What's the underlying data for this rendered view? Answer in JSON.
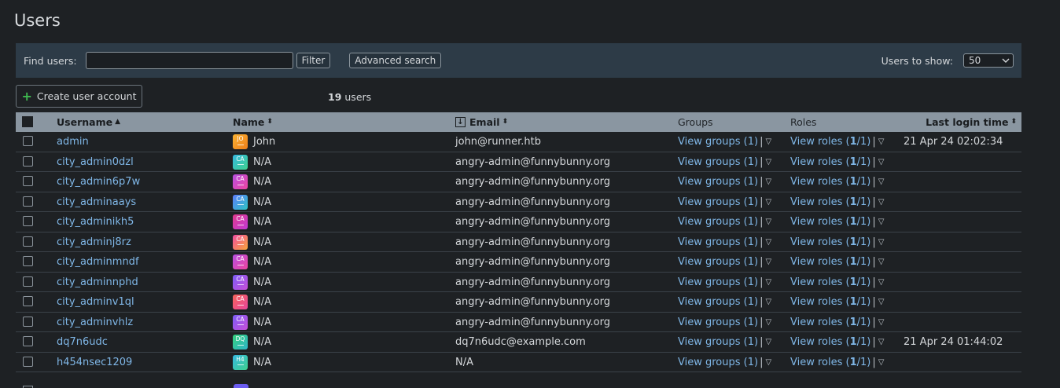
{
  "page": {
    "title": "Users"
  },
  "filter": {
    "find_label": "Find users:",
    "find_value": "",
    "filter_label": "Filter",
    "advanced_label": "Advanced search",
    "show_label": "Users to show:",
    "show_value": "50"
  },
  "toolbar": {
    "create_label": "Create user account",
    "count_number": "19",
    "count_suffix": " users"
  },
  "table": {
    "headers": {
      "username": "Username",
      "name": "Name",
      "email": "Email",
      "groups": "Groups",
      "roles": "Roles",
      "last_login": "Last login time"
    },
    "rows": [
      {
        "username": "admin",
        "avatar": "JO",
        "avatar_color": "#f4952a",
        "name": "John",
        "email": "john@runner.htb",
        "groups": "View groups (1)",
        "roles_prefix": "View roles (",
        "roles_bold": "1",
        "roles_suffix": "/1)",
        "last_login": "21 Apr 24 02:02:34"
      },
      {
        "username": "city_admin0dzl",
        "avatar": "CA",
        "avatar_color": "#35b8e0",
        "name": "N/A",
        "email": "angry-admin@funnybunny.org",
        "groups": "View groups (1)",
        "roles_prefix": "View roles (",
        "roles_bold": "1",
        "roles_suffix": "/1)",
        "last_login": ""
      },
      {
        "username": "city_admin6p7w",
        "avatar": "CA",
        "avatar_color": "#b64fe0",
        "name": "N/A",
        "email": "angry-admin@funnybunny.org",
        "groups": "View groups (1)",
        "roles_prefix": "View roles (",
        "roles_bold": "1",
        "roles_suffix": "/1)",
        "last_login": ""
      },
      {
        "username": "city_adminaays",
        "avatar": "CA",
        "avatar_color": "#5c7cfa",
        "name": "N/A",
        "email": "angry-admin@funnybunny.org",
        "groups": "View groups (1)",
        "roles_prefix": "View roles (",
        "roles_bold": "1",
        "roles_suffix": "/1)",
        "last_login": ""
      },
      {
        "username": "city_adminikh5",
        "avatar": "CA",
        "avatar_color": "#e03a8c",
        "name": "N/A",
        "email": "angry-admin@funnybunny.org",
        "groups": "View groups (1)",
        "roles_prefix": "View roles (",
        "roles_bold": "1",
        "roles_suffix": "/1)",
        "last_login": ""
      },
      {
        "username": "city_adminj8rz",
        "avatar": "CA",
        "avatar_color": "#ef4da1",
        "name": "N/A",
        "email": "angry-admin@funnybunny.org",
        "groups": "View groups (1)",
        "roles_prefix": "View roles (",
        "roles_bold": "1",
        "roles_suffix": "/1)",
        "last_login": ""
      },
      {
        "username": "city_adminmndf",
        "avatar": "CA",
        "avatar_color": "#b64fe0",
        "name": "N/A",
        "email": "angry-admin@funnybunny.org",
        "groups": "View groups (1)",
        "roles_prefix": "View roles (",
        "roles_bold": "1",
        "roles_suffix": "/1)",
        "last_login": ""
      },
      {
        "username": "city_adminnphd",
        "avatar": "CA",
        "avatar_color": "#7b5cf5",
        "name": "N/A",
        "email": "angry-admin@funnybunny.org",
        "groups": "View groups (1)",
        "roles_prefix": "View roles (",
        "roles_bold": "1",
        "roles_suffix": "/1)",
        "last_login": ""
      },
      {
        "username": "city_adminv1ql",
        "avatar": "CA",
        "avatar_color": "#f5645a",
        "name": "N/A",
        "email": "angry-admin@funnybunny.org",
        "groups": "View groups (1)",
        "roles_prefix": "View roles (",
        "roles_bold": "1",
        "roles_suffix": "/1)",
        "last_login": ""
      },
      {
        "username": "city_adminvhlz",
        "avatar": "CA",
        "avatar_color": "#c84fd8",
        "name": "N/A",
        "email": "angry-admin@funnybunny.org",
        "groups": "View groups (1)",
        "roles_prefix": "View roles (",
        "roles_bold": "1",
        "roles_suffix": "/1)",
        "last_login": ""
      },
      {
        "username": "dq7n6udc",
        "avatar": "DQ",
        "avatar_color": "#36d17c",
        "name": "N/A",
        "email": "dq7n6udc@example.com",
        "groups": "View groups (1)",
        "roles_prefix": "View roles (",
        "roles_bold": "1",
        "roles_suffix": "/1)",
        "last_login": "21 Apr 24 01:44:02"
      },
      {
        "username": "h454nsec1209",
        "avatar": "H4",
        "avatar_color": "#2fb5c9",
        "name": "N/A",
        "email": "N/A",
        "groups": "View groups (1)",
        "roles_prefix": "View roles (",
        "roles_bold": "1",
        "roles_suffix": "/1)",
        "last_login": ""
      }
    ]
  }
}
